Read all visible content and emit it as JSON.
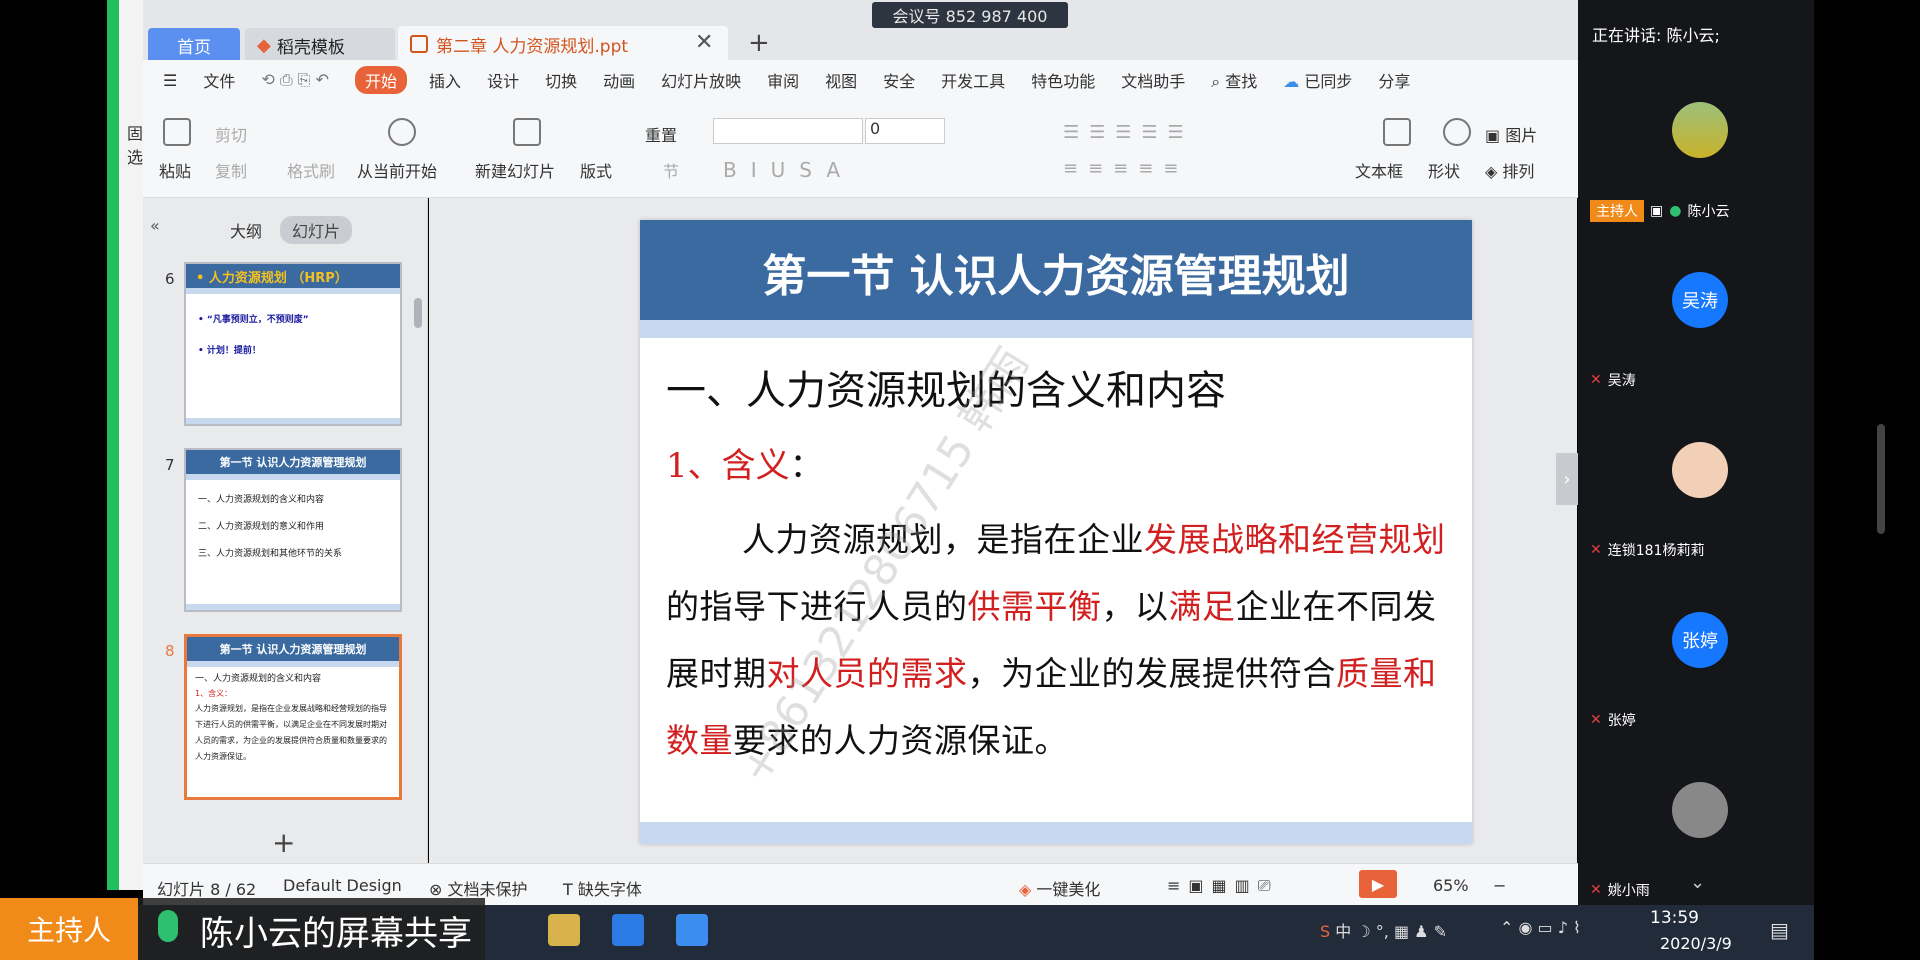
{
  "meeting": {
    "id_label": "会议号 852 987 400",
    "speaking": "正在讲话: 陈小云;"
  },
  "tabs": [
    {
      "label": "首页"
    },
    {
      "label": "稻壳模板"
    },
    {
      "label": "第二章 人力资源规划.ppt"
    }
  ],
  "menu": {
    "file": "文件",
    "start": "开始",
    "items": [
      "插入",
      "设计",
      "切换",
      "动画",
      "幻灯片放映",
      "审阅",
      "视图",
      "安全",
      "开发工具",
      "特色功能",
      "文档助手"
    ],
    "search": "查找",
    "synced": "已同步",
    "share": "分享"
  },
  "ribbon": {
    "paste": "粘贴",
    "cut": "剪切",
    "copy": "复制",
    "format_painter": "格式刷",
    "from_current": "从当前开始",
    "new_slide": "新建幻灯片",
    "layout": "版式",
    "reset": "重置",
    "section": "节",
    "font_size": "0",
    "textbox": "文本框",
    "shape": "形状",
    "picture": "图片",
    "arrange": "排列",
    "left_cut1": "固",
    "left_cut2": "选"
  },
  "pane": {
    "outline": "大纲",
    "slides": "幻灯片"
  },
  "thumbs": [
    {
      "num": "6",
      "title": "• 人力资源规划 （HRP）",
      "lines": [
        "• “凡事预则立，不预则废”",
        "•   计划！提前！"
      ]
    },
    {
      "num": "7",
      "title": "第一节  认识人力资源管理规划",
      "lines": [
        "一、人力资源规划的含义和内容",
        "二、人力资源规划的意义和作用",
        "三、人力资源规划和其他环节的关系"
      ]
    },
    {
      "num": "8",
      "title": "第一节  认识人力资源管理规划",
      "lines": [
        "一、人力资源规划的含义和内容",
        "1、含义：",
        "人力资源规划，是指在企业发展战略和经营规划的指导下进行人员的供需平衡，以满足企业在不同发展时期对人员的需求，为企业的发展提供符合质量和数量要求的人力资源保证。"
      ]
    }
  ],
  "slide": {
    "title": "第一节  认识人力资源管理规划",
    "heading": "一、人力资源规划的含义和内容",
    "subheading": "1、含义",
    "colon": "：",
    "body": {
      "p1": "人力资源规划，是指在企业",
      "r1": "发展战略和经营规划",
      "p2": "的指导下进行人员的",
      "r2": "供需平衡",
      "p3": "，以",
      "r3": "满足",
      "p4": "企业在不同发展时期",
      "r4": "对人员的需求",
      "p5": "，为企业的发展提供符合",
      "r5": "质量和数量",
      "p6": "要求的人力资源保证。"
    },
    "watermark": "+8613212806715 韩雨"
  },
  "status": {
    "slide_count": "幻灯片 8 / 62",
    "design": "Default Design",
    "protect": "文档未保护",
    "missing_font": "缺失字体",
    "beautify": "一键美化",
    "zoom": "65%"
  },
  "participants": [
    {
      "name": "陈小云",
      "role": "主持人",
      "avatar_text": ""
    },
    {
      "name": "吴涛",
      "avatar_text": "吴涛"
    },
    {
      "name": "连锁181杨莉莉",
      "avatar_text": ""
    },
    {
      "name": "张婷",
      "avatar_text": "张婷"
    },
    {
      "name": "姚小雨",
      "avatar_text": ""
    }
  ],
  "share": {
    "host_label": "主持人",
    "share_text": "陈小云的屏幕共享"
  },
  "taskbar": {
    "time": "13:59",
    "date": "2020/3/9",
    "ime": "中"
  },
  "colors": {
    "accent": "#e8633a",
    "slide_blue": "#3a6aa0",
    "host_orange": "#f08a18",
    "avatar_blue": "#1677ff"
  }
}
